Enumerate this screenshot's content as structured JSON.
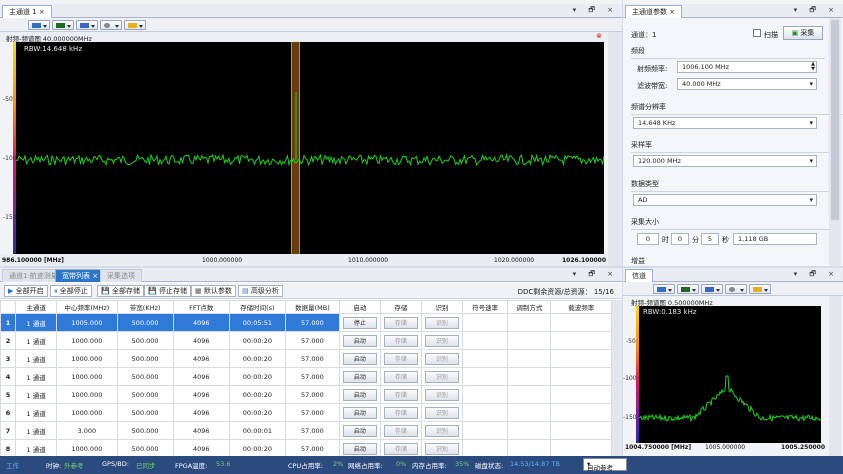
{
  "main_tab": {
    "title": "主通道 1"
  },
  "spectrum_main": {
    "subtitle": "射频-频谱图 40.000000MHz",
    "rbw": "RBW:14.648 kHz",
    "y_ticks": [
      "-50",
      "-100",
      "-150"
    ],
    "x_labels": [
      "986.100000 [MHz]",
      "1000.000000",
      "1010.000000",
      "1020.000000",
      "1026.100000"
    ],
    "trace_color": "#1fd11f"
  },
  "params": {
    "tab": "主通道参数",
    "channel": "通道：1",
    "scan_label": "扫描",
    "collect_label": "采集",
    "group_freq": "频段",
    "rf_label": "射频频率:",
    "rf_value": "1006.100 MHz",
    "bw_label": "滤波带宽:",
    "bw_value": "40.000 MHz",
    "group_res": "频谱分辨率",
    "res_value": "14.648 KHz",
    "group_rate": "采样率",
    "rate_value": "120.000 MHz",
    "group_dtype": "数据类型",
    "dtype_value": "AD",
    "group_size": "采集大小",
    "size_d": "0",
    "size_d_unit": "时",
    "size_h": "0",
    "size_h_unit": "分",
    "size_m": "5",
    "size_m_unit": "秒",
    "size_total": "1,118 GB",
    "group_gain": "增益"
  },
  "bottom_tabs": {
    "t1": "通道1:航迹测量",
    "t2": "宽带列表",
    "t3": "采集选项"
  },
  "list_toolbar": {
    "start_all": "全部开启",
    "stop_all": "全部停止",
    "store_all": "全部存储",
    "stop_store": "停止存储",
    "default": "默认参数",
    "analyze": "高级分析",
    "ddc": "DDC剩余资源/总资源： 15/16"
  },
  "table": {
    "headers": [
      "",
      "主通道",
      "中心频率(MHz)",
      "带宽(KHz)",
      "FFT点数",
      "存储时间(s)",
      "数据量(MB)",
      "启动",
      "存储",
      "识别",
      "符号速率",
      "调制方式",
      "载波频率"
    ],
    "rows": [
      {
        "n": "1",
        "ch": "1 通道",
        "cf": "1005.000",
        "bw": "500.000",
        "fft": "4096",
        "t": "00:05:51",
        "mb": "57.000",
        "start": "停止",
        "store": "存储",
        "id": "识别"
      },
      {
        "n": "2",
        "ch": "1 通道",
        "cf": "1000.000",
        "bw": "500.000",
        "fft": "4096",
        "t": "00:00:20",
        "mb": "57.000",
        "start": "启动",
        "store": "存储",
        "id": "识别"
      },
      {
        "n": "3",
        "ch": "1 通道",
        "cf": "1000.000",
        "bw": "500.000",
        "fft": "4096",
        "t": "00:00:20",
        "mb": "57.000",
        "start": "启动",
        "store": "存储",
        "id": "识别"
      },
      {
        "n": "4",
        "ch": "1 通道",
        "cf": "1000.000",
        "bw": "500.000",
        "fft": "4096",
        "t": "00:00:20",
        "mb": "57.000",
        "start": "启动",
        "store": "存储",
        "id": "识别"
      },
      {
        "n": "5",
        "ch": "1 通道",
        "cf": "1000.000",
        "bw": "500.000",
        "fft": "4096",
        "t": "00:00:20",
        "mb": "57.000",
        "start": "启动",
        "store": "存储",
        "id": "识别"
      },
      {
        "n": "6",
        "ch": "1 通道",
        "cf": "1000.000",
        "bw": "500.000",
        "fft": "4096",
        "t": "00:00:20",
        "mb": "57.000",
        "start": "启动",
        "store": "存储",
        "id": "识别"
      },
      {
        "n": "7",
        "ch": "1 通道",
        "cf": "3.000",
        "bw": "500.000",
        "fft": "4096",
        "t": "00:00:01",
        "mb": "57.000",
        "start": "启动",
        "store": "存储",
        "id": "识别"
      },
      {
        "n": "8",
        "ch": "1 通道",
        "cf": "1000.000",
        "bw": "500.000",
        "fft": "4096",
        "t": "00:00:20",
        "mb": "57.000",
        "start": "启动",
        "store": "存储",
        "id": "识别"
      }
    ]
  },
  "mini": {
    "tab": "信道",
    "subtitle": "射频-频谱图 0.500000MHz",
    "rbw": "RBW:0.183 kHz",
    "y_ticks": [
      "-50",
      "-100",
      "-150"
    ],
    "x_labels": [
      "1004.750000 [MHz]",
      "1005.000000",
      "1005.250000"
    ]
  },
  "status": {
    "work": "工作",
    "clock_label": "时钟:",
    "clock_val": "外参考",
    "gps_label": "GPS/BD:",
    "gps_val": "已同步",
    "fpga_label": "FPGA温度:",
    "fpga_val": "53.6",
    "cpu_label": "CPU占用率:",
    "cpu_val": "2%",
    "net_label": "网络占用率:",
    "net_val": "0%",
    "mem_label": "内存占用率:",
    "mem_val": "35%",
    "disk_label": "磁盘状态:",
    "disk_val": "14.53/14.87 TB",
    "ref": "自动参考"
  }
}
